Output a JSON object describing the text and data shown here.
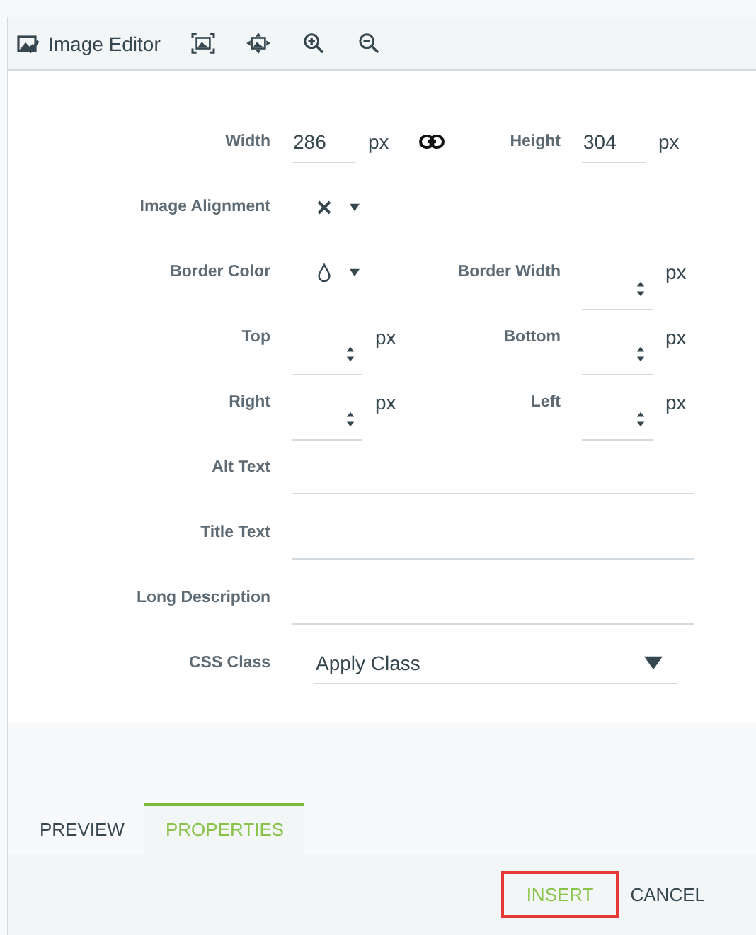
{
  "toolbar": {
    "title": "Image Editor"
  },
  "rows": [
    {
      "left": {
        "kind": "number",
        "label": "Width",
        "value": "286",
        "unit": "px"
      },
      "linked": true,
      "right": {
        "kind": "number",
        "label": "Height",
        "value": "304",
        "unit": "px"
      }
    },
    {
      "left": {
        "kind": "align-picker",
        "label": "Image Alignment"
      }
    },
    {
      "left": {
        "kind": "color-picker",
        "label": "Border Color"
      },
      "right": {
        "kind": "spinner",
        "label": "Border Width",
        "unit": "px"
      }
    },
    {
      "left": {
        "kind": "spinner",
        "label": "Top",
        "unit": "px"
      },
      "right": {
        "kind": "spinner",
        "label": "Bottom",
        "unit": "px"
      }
    },
    {
      "left": {
        "kind": "spinner",
        "label": "Right",
        "unit": "px"
      },
      "right": {
        "kind": "spinner",
        "label": "Left",
        "unit": "px"
      }
    },
    {
      "left": {
        "kind": "line",
        "label": "Alt Text"
      }
    },
    {
      "left": {
        "kind": "line",
        "label": "Title Text"
      }
    },
    {
      "left": {
        "kind": "line",
        "label": "Long Description"
      }
    },
    {
      "left": {
        "kind": "select",
        "label": "CSS Class",
        "value": "Apply Class"
      }
    }
  ],
  "tabs": [
    {
      "label": "PREVIEW",
      "selected": false
    },
    {
      "label": "PROPERTIES",
      "selected": true
    }
  ],
  "buttons": [
    {
      "label": "INSERT",
      "kind": "primary",
      "highlighted": true
    },
    {
      "label": "CANCEL",
      "kind": "plain",
      "highlighted": false
    }
  ]
}
